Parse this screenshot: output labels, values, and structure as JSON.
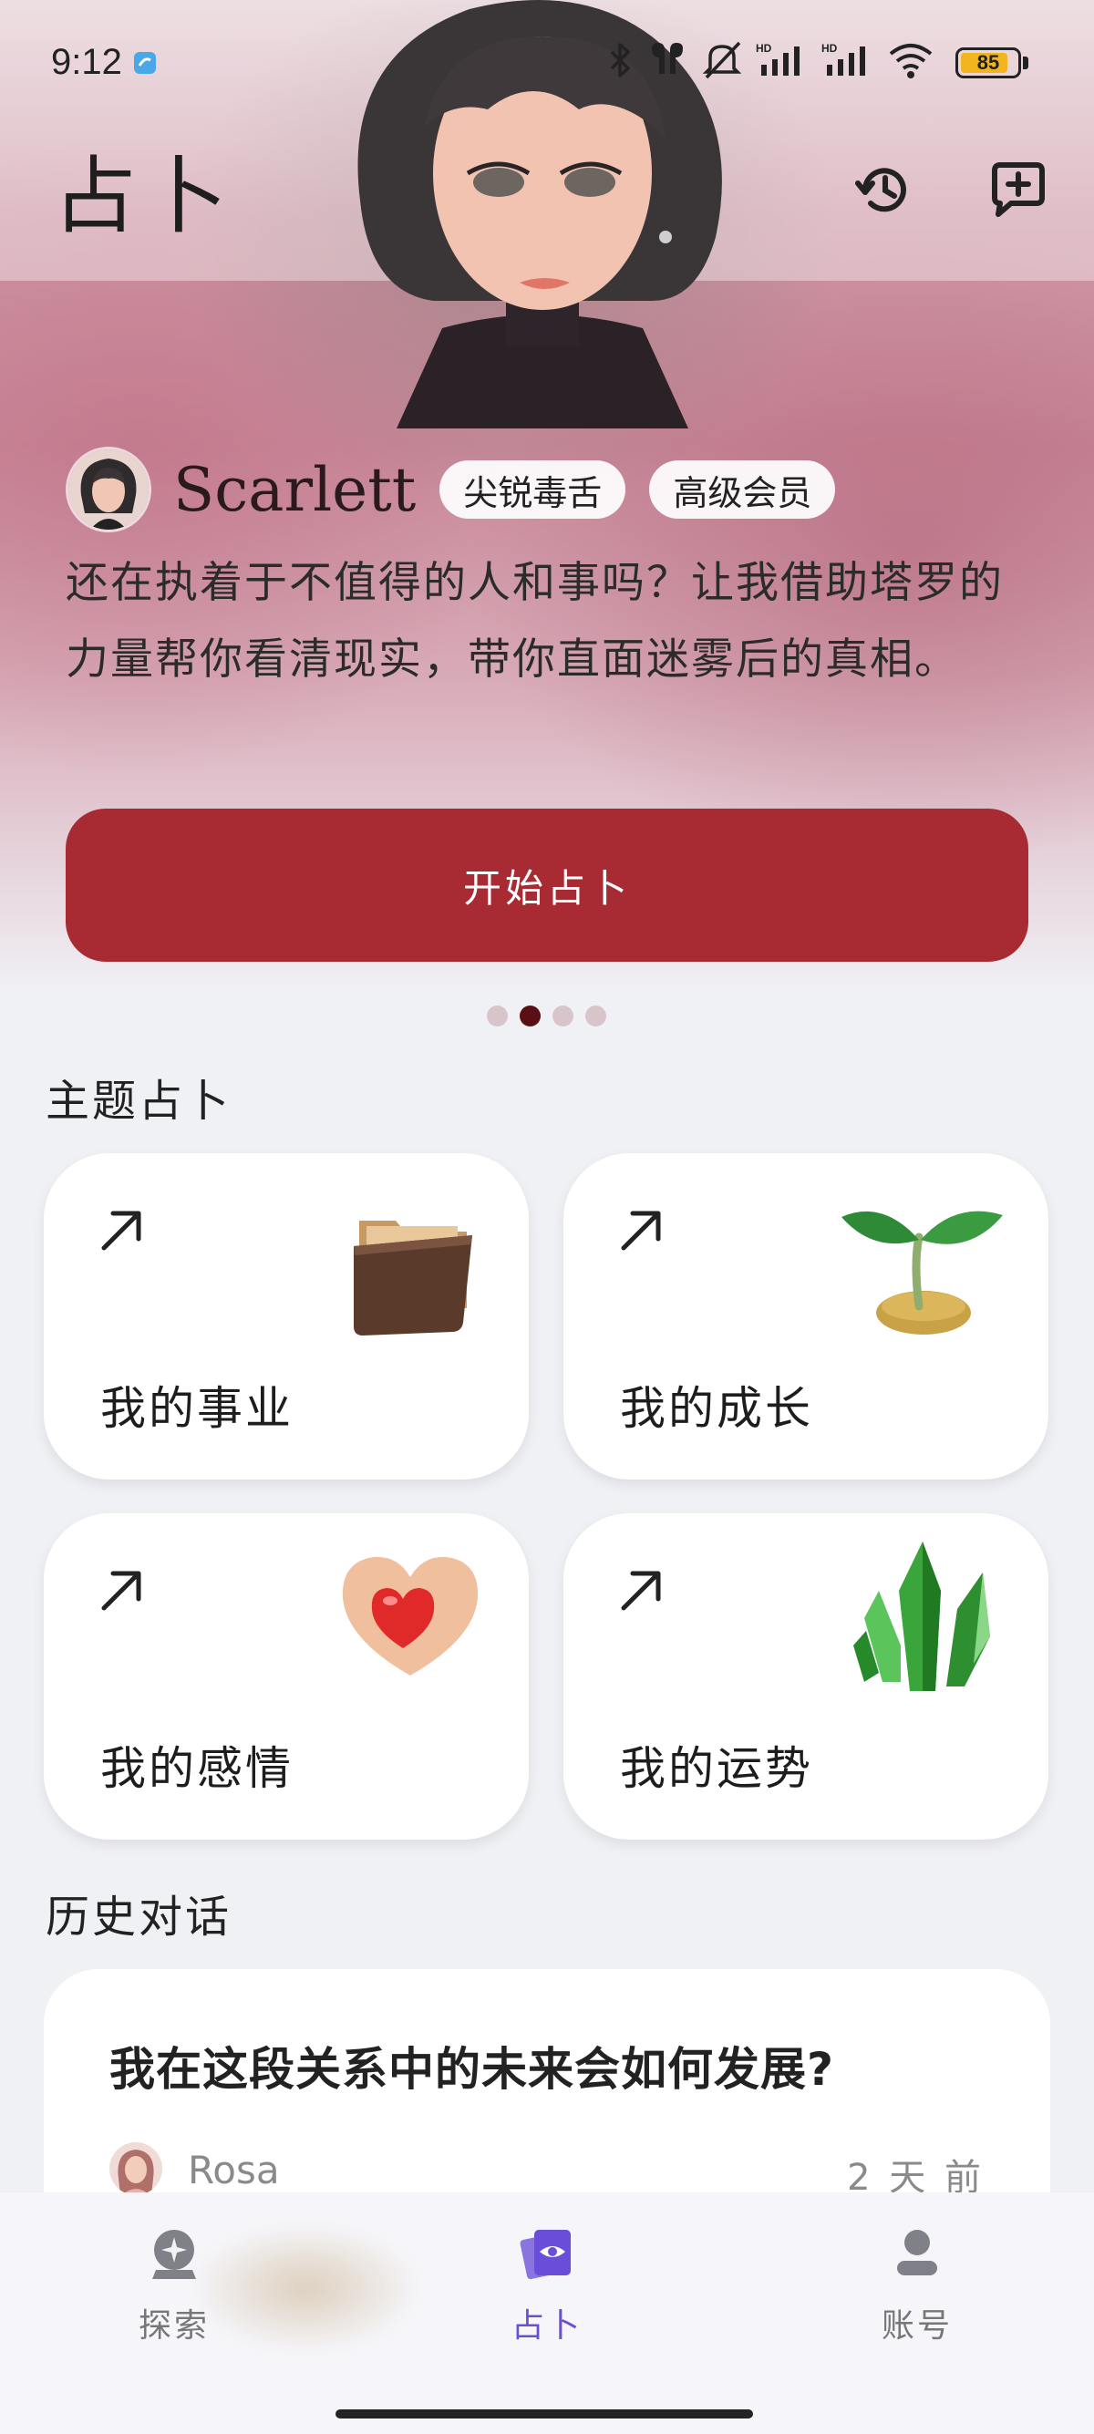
{
  "status_bar": {
    "time": "9:12",
    "battery": "85",
    "battery_level": 0.85,
    "icons": [
      "bluetooth-icon",
      "earbuds-icon",
      "mute-icon",
      "signal-hd-1-icon",
      "signal-hd-2-icon",
      "wifi-icon"
    ]
  },
  "header": {
    "title": "占卜",
    "actions": [
      "history-icon",
      "chat-add-icon"
    ]
  },
  "hero": {
    "name": "Scarlett",
    "tags": [
      "尖锐毒舌",
      "高级会员"
    ],
    "description": "还在执着于不值得的人和事吗？让我借助塔罗的力量帮你看清现实，带你直面迷雾后的真相。",
    "button_label": "开始占卜",
    "button_color": "#a82a32",
    "pager_active_index": 1,
    "pager_total": 4
  },
  "themes": {
    "title": "主题占卜",
    "cards": [
      {
        "label": "我的事业",
        "icon": "folder-icon"
      },
      {
        "label": "我的成长",
        "icon": "sprout-icon"
      },
      {
        "label": "我的感情",
        "icon": "heart-icon"
      },
      {
        "label": "我的运势",
        "icon": "crystal-icon"
      }
    ]
  },
  "history": {
    "title": "历史对话",
    "items": [
      {
        "question": "我在这段关系中的未来会如何发展?",
        "user": "Rosa",
        "time": "2 天 前"
      }
    ]
  },
  "tabs": [
    {
      "label": "探索",
      "icon": "crystal-ball-icon",
      "active": false
    },
    {
      "label": "占卜",
      "icon": "tarot-eye-icon",
      "active": true
    },
    {
      "label": "账号",
      "icon": "account-icon",
      "active": false
    }
  ],
  "colors": {
    "accent": "#a82a32",
    "tab_active": "#6a4ed9",
    "background": "#f0f1f5"
  }
}
